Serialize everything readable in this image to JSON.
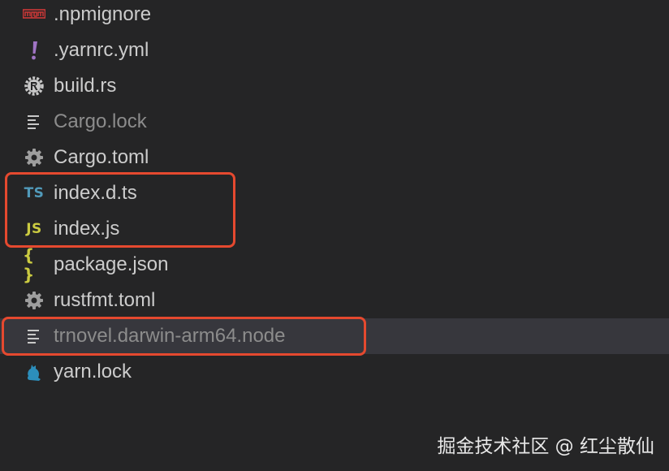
{
  "files": [
    {
      "name": ".npmignore",
      "icon": "npm-icon",
      "icon_color": "#cb3837",
      "dim": false,
      "selected": false
    },
    {
      "name": ".yarnrc.yml",
      "icon": "exclamation-icon",
      "icon_color": "#a074c4",
      "dim": false,
      "selected": false
    },
    {
      "name": "build.rs",
      "icon": "rust-icon",
      "icon_color": "#c8c8c8",
      "dim": false,
      "selected": false
    },
    {
      "name": "Cargo.lock",
      "icon": "text-lines-icon",
      "icon_color": "#c8c8c8",
      "dim": true,
      "selected": false
    },
    {
      "name": "Cargo.toml",
      "icon": "gear-icon",
      "icon_color": "#9e9e9e",
      "dim": false,
      "selected": false
    },
    {
      "name": "index.d.ts",
      "icon_text": "TS",
      "icon": "typescript-icon",
      "icon_color": "#519aba",
      "dim": false,
      "selected": false
    },
    {
      "name": "index.js",
      "icon_text": "JS",
      "icon": "javascript-icon",
      "icon_color": "#cbcb41",
      "dim": false,
      "selected": false
    },
    {
      "name": "package.json",
      "icon_text": "{ }",
      "icon": "json-braces-icon",
      "icon_color": "#cbcb41",
      "dim": false,
      "selected": false
    },
    {
      "name": "rustfmt.toml",
      "icon": "gear-icon",
      "icon_color": "#9e9e9e",
      "dim": false,
      "selected": false
    },
    {
      "name": "trnovel.darwin-arm64.node",
      "icon": "text-lines-icon",
      "icon_color": "#c8c8c8",
      "dim": true,
      "selected": true
    },
    {
      "name": "yarn.lock",
      "icon": "yarn-cat-icon",
      "icon_color": "#2c8ebb",
      "dim": false,
      "selected": false
    }
  ],
  "colors": {
    "background": "#252526",
    "selection": "#37373d",
    "highlight_border": "#e5492f",
    "text": "#cccccc",
    "text_dim": "#8c8c8c"
  },
  "watermark": "掘金技术社区 @ 红尘散仙"
}
